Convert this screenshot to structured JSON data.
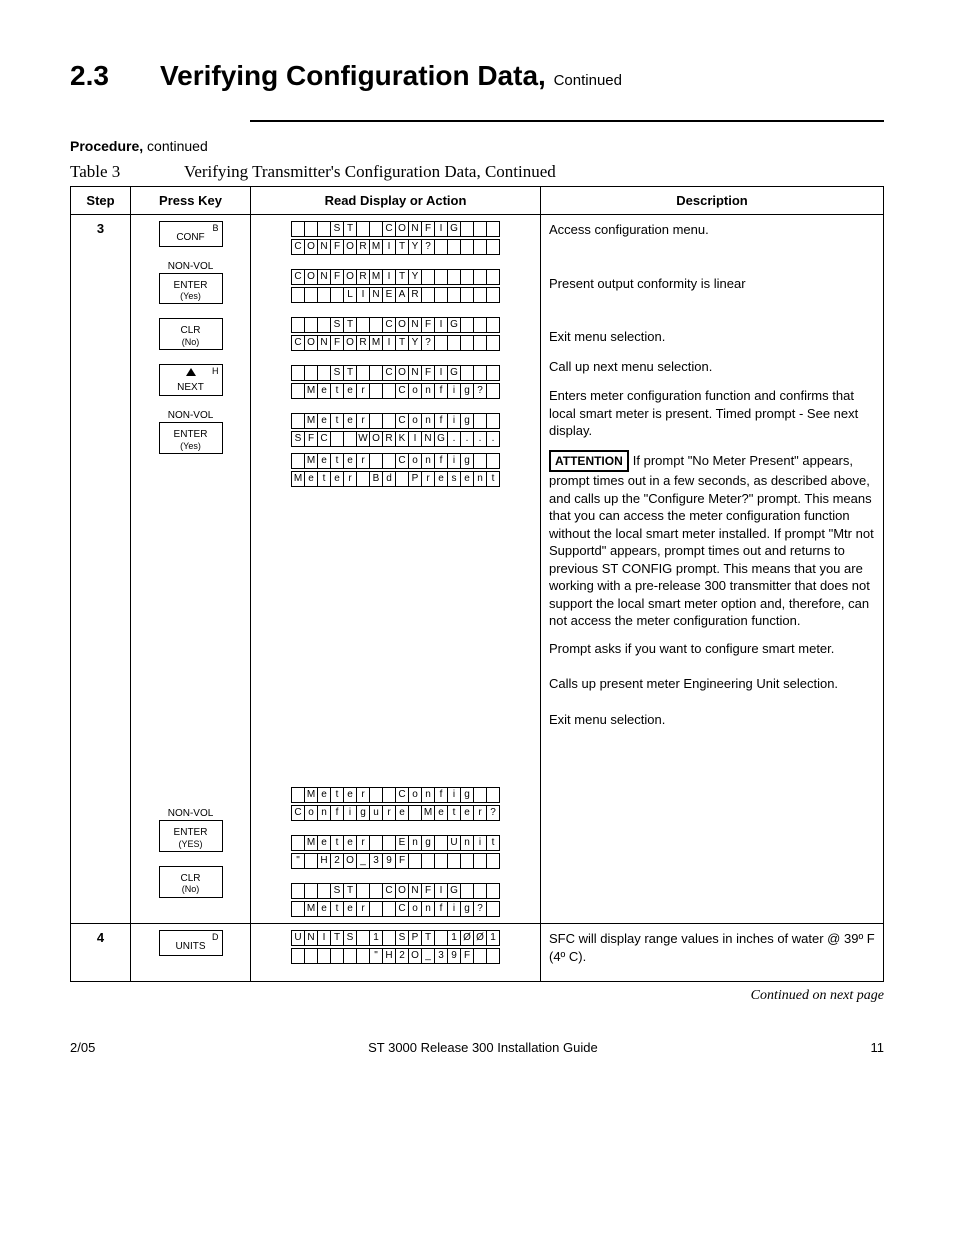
{
  "header": {
    "section_num": "2.3",
    "section_title": "Verifying Configuration Data,",
    "section_cont": "Continued"
  },
  "procedure_label": "Procedure,",
  "procedure_cont": " continued",
  "table_caption_label": "Table 3",
  "table_caption_text": "Verifying Transmitter's Configuration Data, Continued",
  "columns": {
    "c1": "Step",
    "c2": "Press Key",
    "c3": "Read Display or Action",
    "c4": "Description"
  },
  "step3": {
    "num": "3",
    "keys": {
      "conf": {
        "corner": "B",
        "main": "CONF"
      },
      "enter1": {
        "top": "NON-VOL",
        "main": "ENTER",
        "sub": "(Yes)"
      },
      "clr1": {
        "main": "CLR",
        "sub": "(No)"
      },
      "next": {
        "corner": "H",
        "main": "NEXT"
      },
      "enter2": {
        "top": "NON-VOL",
        "main": "ENTER",
        "sub": "(Yes)"
      },
      "enter3": {
        "top": "NON-VOL",
        "main": "ENTER",
        "sub": "(YES)"
      },
      "clr2": {
        "main": "CLR",
        "sub": "(No)"
      }
    },
    "displays": {
      "d1": {
        "l1": "   ST  CONFIG   ",
        "l2": "CONFORMITY?     "
      },
      "d2": {
        "l1": "CONFORMITY      ",
        "l2": "    LINEAR      "
      },
      "d3": {
        "l1": "   ST  CONFIG   ",
        "l2": "CONFORMITY?     "
      },
      "d4": {
        "l1": "   ST  CONFIG   ",
        "l2": " Meter  Config? "
      },
      "d5a": {
        "l1": " Meter  Config  ",
        "l2": "SFC  WORKING....."
      },
      "d5b": {
        "l1": " Meter  Config  ",
        "l2": "Meter Bd Present"
      },
      "d6": {
        "l1": " Meter  Config  ",
        "l2": "Configure Meter?"
      },
      "d7": {
        "l1": " Meter  Eng Units",
        "l2": "\" H2O_39F       "
      },
      "d8": {
        "l1": "   ST  CONFIG   ",
        "l2": " Meter  Config? "
      }
    },
    "desc": {
      "p1": "Access configuration menu.",
      "p2": "Present output conformity is linear",
      "p3": "Exit menu selection.",
      "p4": "Call up next menu selection.",
      "p5": "Enters meter configuration function and confirms that local smart meter is present. Timed prompt - See next display.",
      "attention_label": "ATTENTION",
      "p6": "If prompt \"No Meter Present\" appears, prompt times out in a few seconds, as described above,  and calls up the \"Configure Meter?\" prompt. This means that you can access the meter configuration function without the local smart meter installed. If prompt \"Mtr not Supportd\" appears, prompt times out and returns to previous ST CONFIG prompt. This means that you are working with a pre-release 300 transmitter that does not support the local smart meter option and, therefore, can not access the meter configuration function.",
      "p7": "Prompt asks if you want to configure smart meter.",
      "p8": "Calls up present meter Engineering Unit selection.",
      "p9": "Exit menu selection."
    }
  },
  "step4": {
    "num": "4",
    "key": {
      "corner": "D",
      "main": "UNITS"
    },
    "display": {
      "l1": "UNITS 1 SPT 1ØØ1",
      "l2": "      \"H2O_39F  "
    },
    "desc": "SFC will display range values in inches of water @ 39º F (4º C)."
  },
  "cont_note": "Continued on next page",
  "footer": {
    "left": "2/05",
    "center": "ST 3000 Release 300 Installation Guide",
    "right": "11"
  }
}
